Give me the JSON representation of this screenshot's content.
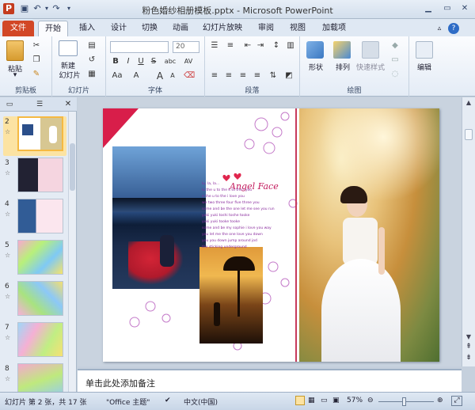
{
  "window": {
    "title": "粉色婚纱相册模板.pptx - Microsoft PowerPoint"
  },
  "tabs": [
    "文件",
    "开始",
    "插入",
    "设计",
    "切换",
    "动画",
    "幻灯片放映",
    "审阅",
    "视图",
    "加载项"
  ],
  "ribbon": {
    "clipboard": {
      "label": "剪贴板",
      "paste": "粘贴"
    },
    "slides": {
      "label": "幻灯片",
      "new_slide_1": "新建",
      "new_slide_2": "幻灯片"
    },
    "font": {
      "label": "字体",
      "size": "20",
      "bold": "B",
      "italic": "I",
      "underline": "U",
      "strike": "S",
      "shadow": "abc",
      "spacing": "AV",
      "case": "Aa",
      "grow": "A",
      "shrink": "A",
      "color": "A"
    },
    "paragraph": {
      "label": "段落"
    },
    "drawing": {
      "label": "绘图",
      "shape": "形状",
      "arrange": "排列",
      "quick_styles": "快速样式"
    },
    "editing": {
      "label": "编辑"
    }
  },
  "panel": {
    "slides": [
      {
        "num": "2",
        "selected": true
      },
      {
        "num": "3"
      },
      {
        "num": "4"
      },
      {
        "num": "5"
      },
      {
        "num": "6"
      },
      {
        "num": "7"
      },
      {
        "num": "8"
      }
    ]
  },
  "slide": {
    "script_title": "Angel Face",
    "poem": "lu, la, la...\nlu the u to the k to the i you\ne the u to the i love you\nwe two three four five three you\nsome and be the one let me see you run\nyuki yuki toshi toshe tooke\nyuki yuki tooke tooke\nsome and be my sophie i love you way\nyou let me the one love you down\nyou you down jump around jod\nthe sticking underground"
  },
  "notes": {
    "placeholder": "单击此处添加备注"
  },
  "status": {
    "slide_info": "幻灯片 第 2 张，共 17 张",
    "theme": "\"Office 主题\"",
    "language": "中文(中国)",
    "zoom": "57%"
  }
}
